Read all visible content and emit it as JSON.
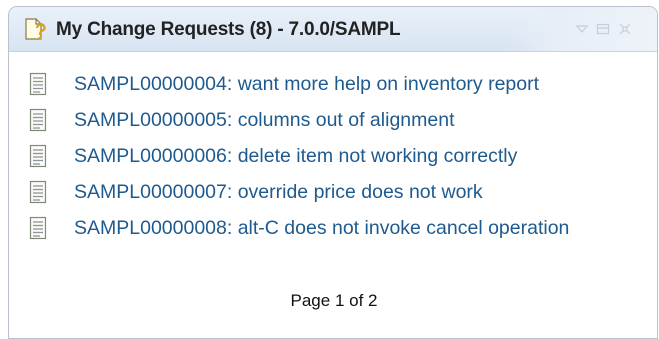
{
  "panel": {
    "title": "My Change Requests (8) - 7.0.0/SAMPL",
    "title_icon": "change-request-icon",
    "controls": [
      {
        "name": "view-menu-icon"
      },
      {
        "name": "minimize-icon"
      },
      {
        "name": "maximize-icon"
      }
    ]
  },
  "items": [
    {
      "label": "SAMPL00000004: want more help on inventory report",
      "icon": "document-icon"
    },
    {
      "label": "SAMPL00000005: columns out of alignment",
      "icon": "document-icon"
    },
    {
      "label": "SAMPL00000006: delete item not working correctly",
      "icon": "document-icon"
    },
    {
      "label": "SAMPL00000007: override price does not work",
      "icon": "document-icon"
    },
    {
      "label": "SAMPL00000008: alt-C does not invoke cancel operation",
      "icon": "document-icon"
    }
  ],
  "pager": {
    "text": "Page 1 of 2"
  },
  "colors": {
    "link": "#1f5a8f",
    "title_bar": "#dfe9f5",
    "border": "#b9c2cc"
  }
}
